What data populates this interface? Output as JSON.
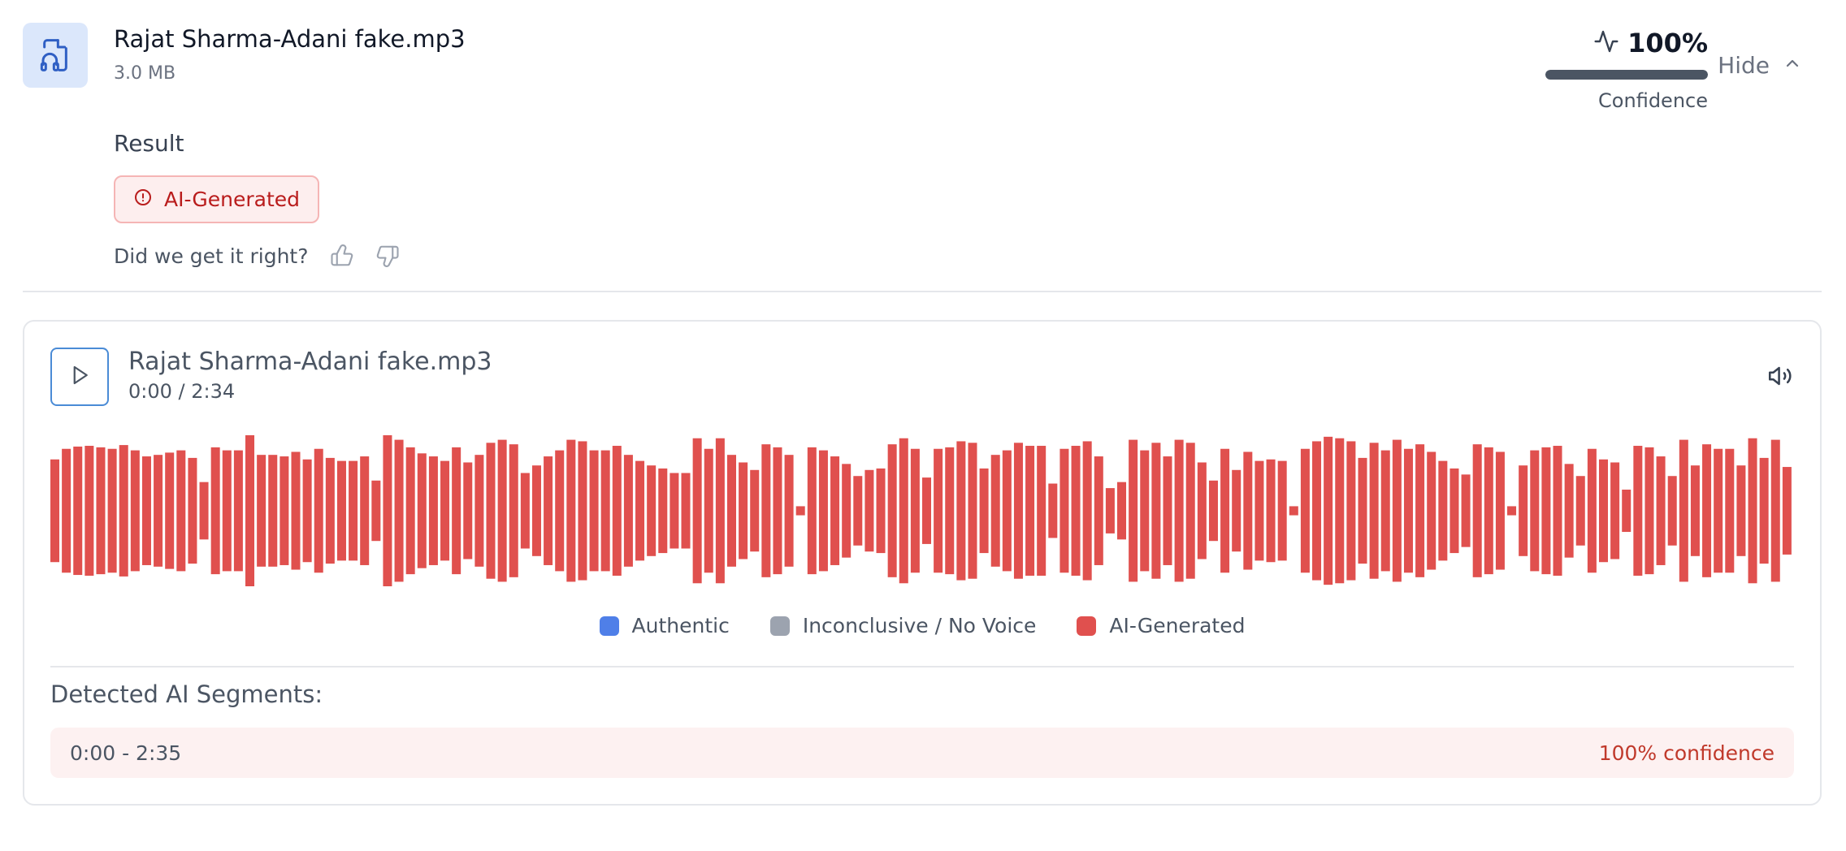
{
  "file": {
    "icon": "audio-file-icon",
    "name": "Rajat Sharma-Adani fake.mp3",
    "size": "3.0 MB"
  },
  "confidence": {
    "icon": "activity-pulse-icon",
    "value": "100%",
    "fraction": 1.0,
    "label": "Confidence"
  },
  "hide_button": {
    "label": "Hide",
    "icon": "chevron-up-icon"
  },
  "result": {
    "label": "Result",
    "badge": "AI-Generated",
    "badge_icon": "alert-circle-icon"
  },
  "feedback": {
    "question": "Did we get it right?",
    "up_icon": "thumbs-up-icon",
    "down_icon": "thumbs-down-icon"
  },
  "player": {
    "play_icon": "play-icon",
    "track_name": "Rajat Sharma-Adani fake.mp3",
    "time": "0:00 / 2:34",
    "volume_icon": "volume-icon"
  },
  "colors": {
    "authentic": "#4f7fe8",
    "inconclusive": "#9ca3af",
    "ai_generated": "#e0504e"
  },
  "waveform_levels": [
    0.68,
    0.82,
    0.85,
    0.86,
    0.84,
    0.82,
    0.87,
    0.8,
    0.72,
    0.74,
    0.77,
    0.8,
    0.7,
    0.38,
    0.84,
    0.8,
    0.8,
    1.0,
    0.74,
    0.74,
    0.72,
    0.78,
    0.68,
    0.82,
    0.7,
    0.66,
    0.66,
    0.72,
    0.4,
    1.0,
    0.94,
    0.84,
    0.76,
    0.72,
    0.66,
    0.84,
    0.64,
    0.74,
    0.9,
    0.94,
    0.88,
    0.5,
    0.6,
    0.72,
    0.8,
    0.94,
    0.92,
    0.8,
    0.8,
    0.86,
    0.74,
    0.66,
    0.6,
    0.56,
    0.5,
    0.5,
    0.96,
    0.82,
    0.96,
    0.74,
    0.64,
    0.54,
    0.88,
    0.84,
    0.74,
    0.06,
    0.84,
    0.8,
    0.72,
    0.62,
    0.46,
    0.54,
    0.56,
    0.88,
    0.96,
    0.82,
    0.44,
    0.82,
    0.84,
    0.92,
    0.9,
    0.56,
    0.74,
    0.8,
    0.9,
    0.86,
    0.86,
    0.36,
    0.82,
    0.86,
    0.92,
    0.72,
    0.3,
    0.38,
    0.94,
    0.8,
    0.9,
    0.72,
    0.94,
    0.9,
    0.64,
    0.4,
    0.82,
    0.54,
    0.78,
    0.66,
    0.68,
    0.66,
    0.06,
    0.82,
    0.92,
    0.98,
    0.96,
    0.92,
    0.7,
    0.9,
    0.8,
    0.94,
    0.82,
    0.88,
    0.78,
    0.66,
    0.56,
    0.48,
    0.88,
    0.84,
    0.78,
    0.06,
    0.6,
    0.8,
    0.84,
    0.86,
    0.62,
    0.46,
    0.82,
    0.68,
    0.64,
    0.28,
    0.86,
    0.84,
    0.72,
    0.46,
    0.94,
    0.6,
    0.88,
    0.82,
    0.82,
    0.6,
    0.96,
    0.7,
    0.94,
    0.58
  ],
  "legend": [
    {
      "label": "Authentic"
    },
    {
      "label": "Inconclusive / No Voice"
    },
    {
      "label": "AI-Generated"
    }
  ],
  "segments": {
    "title": "Detected AI Segments:",
    "items": [
      {
        "range": "0:00 - 2:35",
        "confidence": "100% confidence"
      }
    ]
  }
}
